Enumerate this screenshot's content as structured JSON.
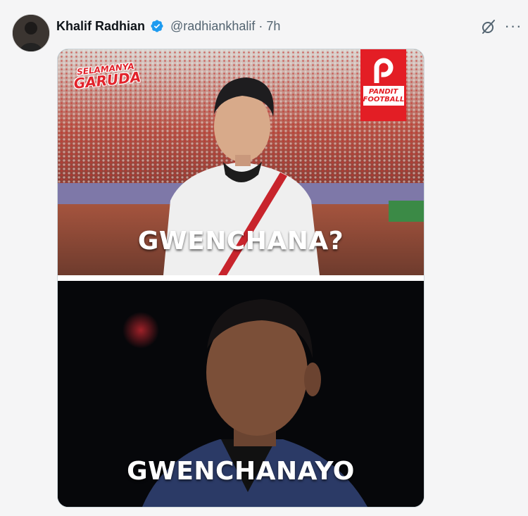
{
  "post": {
    "author_name": "Khalif Radhian",
    "handle": "@radhiankhalif",
    "separator": "·",
    "time": "7h",
    "icons": {
      "verified": "verified-badge-icon",
      "grok": "grok-icon",
      "more": "more-icon"
    },
    "more_label": "···"
  },
  "media": {
    "top_caption": "GWENCHANA?",
    "bottom_caption": "GWENCHANAYO",
    "badge_garuda_line1": "SELAMANYA",
    "badge_garuda_line2": "GARUDA",
    "badge_pandit_line1": "PANDIT",
    "badge_pandit_line2": "FOOTBALL"
  },
  "colors": {
    "verified": "#1d9bf0",
    "text_primary": "#0f1419",
    "text_secondary": "#536471",
    "brand_red": "#e31e25"
  }
}
